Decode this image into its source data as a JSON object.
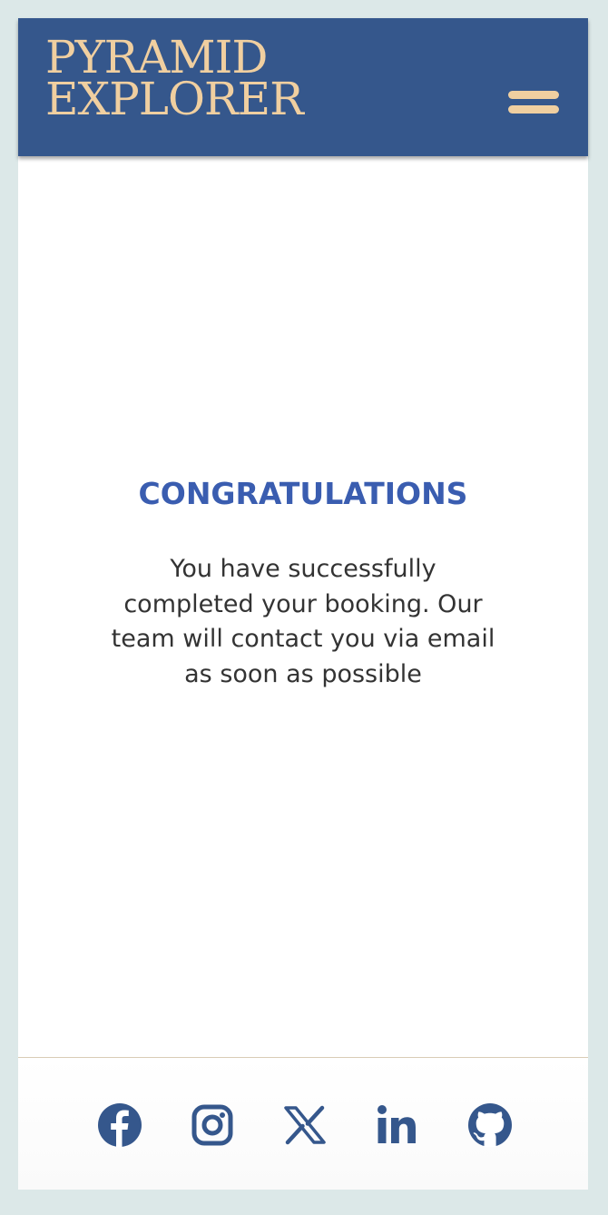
{
  "header": {
    "logo_line1": "PYRAMID",
    "logo_line2": "EXPLORER",
    "menu_icon": "hamburger-menu-icon"
  },
  "main": {
    "title": "CONGRATULATIONS",
    "message": "You have successfully completed your booking. Our team will contact you via email as soon as possible"
  },
  "footer": {
    "social_links": [
      {
        "icon": "facebook-icon"
      },
      {
        "icon": "instagram-icon"
      },
      {
        "icon": "x-icon"
      },
      {
        "icon": "linkedin-icon"
      },
      {
        "icon": "github-icon"
      }
    ]
  },
  "colors": {
    "header_bg": "#35578c",
    "logo": "#f0cfa0",
    "title": "#3a5db0",
    "icons": "#35578c",
    "page_bg": "#dce8e8"
  }
}
